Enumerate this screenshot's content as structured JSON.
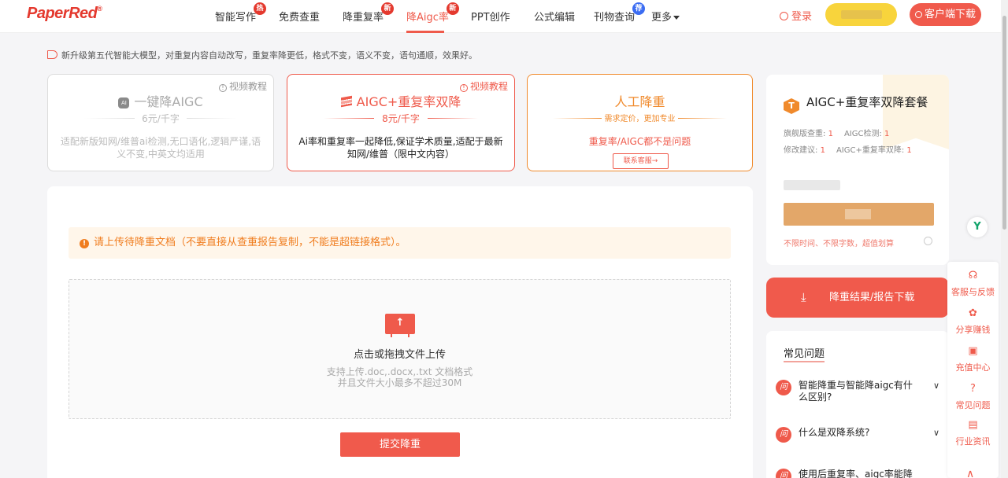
{
  "header": {
    "logo": "PaperRed",
    "logo_mark": "®",
    "nav": [
      {
        "label": "智能写作",
        "badge": "热"
      },
      {
        "label": "免费查重",
        "badge": ""
      },
      {
        "label": "降重复率",
        "badge": "新"
      },
      {
        "label": "降Aigc率",
        "badge": "新"
      },
      {
        "label": "PPT创作",
        "badge": ""
      },
      {
        "label": "公式编辑",
        "badge": ""
      },
      {
        "label": "刊物查询",
        "badge": "荐"
      },
      {
        "label": "更多",
        "badge": ""
      }
    ],
    "login": "登录",
    "download_client": "客户端下载"
  },
  "notice": "新升级第五代智能大模型，对重复内容自动改写，重复率降更低，格式不变，语义不变，语句通顺，效果好。",
  "cards": [
    {
      "video": "视频教程",
      "chip": "AI",
      "title": "一键降AIGC",
      "price": "6元/千字",
      "desc": "适配新版知网/维普ai检测,无口语化,逻辑严谨,语义不变,中英文均适用"
    },
    {
      "video": "视频教程",
      "title": "AIGC+重复率双降",
      "price": "8元/千字",
      "desc": "Ai率和重复率一起降低,保证学术质量,适配于最新知网/维普（限中文内容）"
    },
    {
      "title": "人工降重",
      "price": "需求定价，更加专业",
      "desc": "重复率/AIGC都不是问题",
      "button": "联系客服→"
    }
  ],
  "main": {
    "warning": "请上传待降重文档（不要直接从查重报告复制，不能是超链接格式）。",
    "upload_title": "点击或拖拽文件上传",
    "upload_hint_1": "支持上传.doc,.docx,.txt 文档格式",
    "upload_hint_2": "并且文件大小最多不超过30M",
    "submit": "提交降重"
  },
  "package": {
    "icon": "T",
    "title": "AIGC+重复率双降套餐",
    "row1_a_label": "旗舰版查重:",
    "row1_a_value": "1",
    "row1_b_label": "AIGC检测:",
    "row1_b_value": "1",
    "row2_a_label": "修改建议:",
    "row2_a_value": "1",
    "row2_b_label": "AIGC+重复率双降:",
    "row2_b_value": "1",
    "footer": "不限时间、不限字数，超值划算"
  },
  "download_report": "降重结果/报告下载",
  "faq": {
    "title": "常见问题",
    "q_badge": "问",
    "items": [
      "智能降重与智能降aigc有什么区别?",
      "什么是双降系统?",
      "使用后重复率、aigc率能降到"
    ]
  },
  "sidebar": [
    {
      "label": "客服与反馈",
      "icon": "headset-icon"
    },
    {
      "label": "分享赚钱",
      "icon": "share-icon"
    },
    {
      "label": "充值中心",
      "icon": "recharge-icon"
    },
    {
      "label": "常见问题",
      "icon": "question-icon"
    },
    {
      "label": "行业资讯",
      "icon": "news-icon"
    }
  ],
  "colors": {
    "accent": "#ef5a4b",
    "orange": "#f08a2c",
    "gold": "#e3a769",
    "yellow": "#f8d43c"
  }
}
